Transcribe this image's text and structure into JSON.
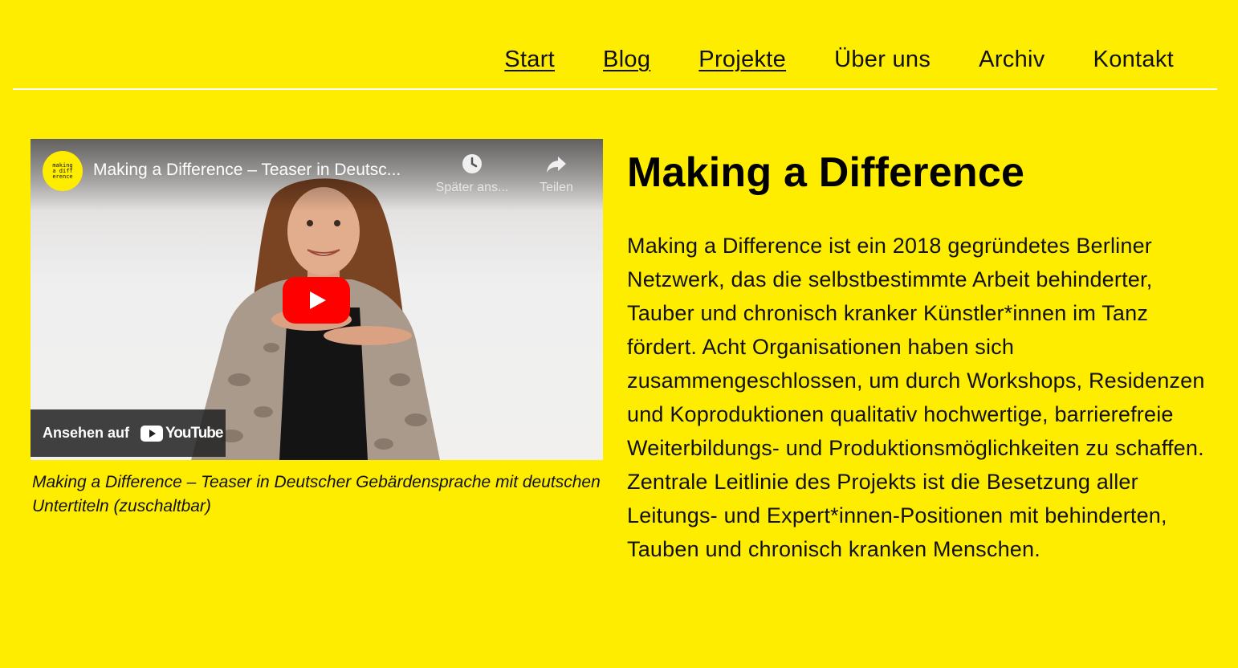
{
  "nav": {
    "items": [
      {
        "label": "Start",
        "underlined": true
      },
      {
        "label": "Blog",
        "underlined": true
      },
      {
        "label": "Projekte",
        "underlined": true
      },
      {
        "label": "Über uns",
        "underlined": false
      },
      {
        "label": "Archiv",
        "underlined": false
      },
      {
        "label": "Kontakt",
        "underlined": false
      }
    ]
  },
  "video": {
    "channel_logo_text": [
      "making",
      "a diff",
      "erence"
    ],
    "title": "Making a Difference – Teaser in Deutsc...",
    "watch_later_label": "Später ans...",
    "share_label": "Teilen",
    "watch_on_label": "Ansehen auf",
    "youtube_word": "YouTube",
    "caption": "Making a Difference – Teaser in Deutscher Gebärdensprache mit deutschen Untertiteln (zuschaltbar)"
  },
  "article": {
    "title": "Making a Difference",
    "body": "Making a Difference ist ein 2018 gegründetes Berliner Netzwerk, das die selbstbestimmte Arbeit behinderter, Tauber und chronisch kranker Künstler*innen im Tanz fördert. Acht Organisationen haben sich zusammengeschlossen, um durch Workshops, Residenzen und Koproduktionen qualitativ hochwertige, barrierefreie Weiterbildungs- und Produktionsmöglichkeiten zu schaffen. Zentrale Leitlinie des Projekts ist die Besetzung aller Leitungs- und Expert*innen-Positionen mit behinderten, Tauben und chronisch kranken Menschen."
  },
  "colors": {
    "background": "#ffed00",
    "youtube_red": "#ff0000"
  }
}
